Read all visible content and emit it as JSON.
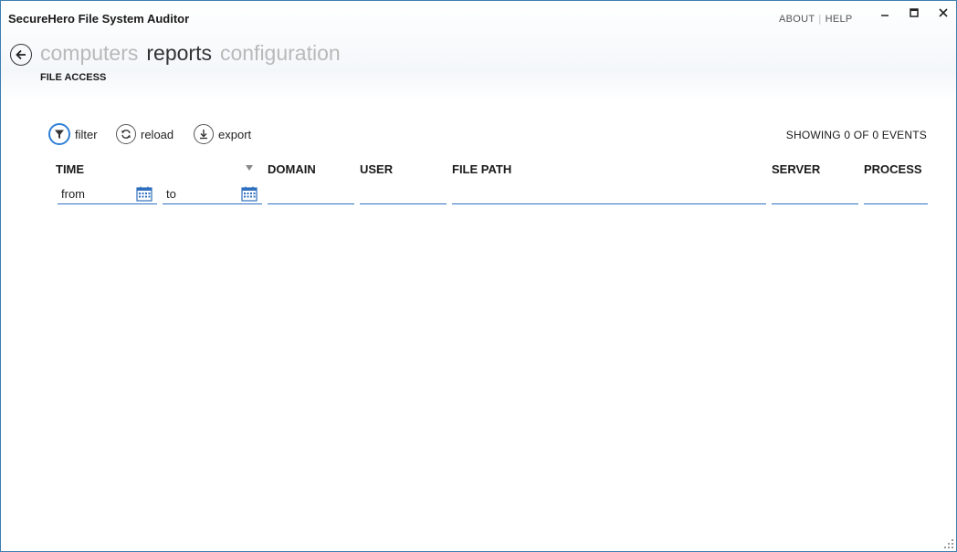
{
  "window": {
    "title": "SecureHero File System Auditor",
    "links": {
      "about": "ABOUT",
      "separator": "|",
      "help": "HELP"
    },
    "controls": {
      "minimize": "–",
      "maximize": "□",
      "close": "✕"
    }
  },
  "nav": {
    "items": [
      {
        "label": "computers",
        "state": "inactive"
      },
      {
        "label": "reports",
        "state": "active"
      },
      {
        "label": "configuration",
        "state": "inactive"
      }
    ],
    "section": "FILE ACCESS"
  },
  "toolbar": {
    "filter_label": "filter",
    "reload_label": "reload",
    "export_label": "export",
    "events_status": "SHOWING 0 OF 0 EVENTS"
  },
  "table": {
    "columns": [
      "TIME",
      "DOMAIN",
      "USER",
      "FILE PATH",
      "SERVER",
      "PROCESS"
    ],
    "filters": {
      "time_from_placeholder": "from",
      "time_to_placeholder": "to",
      "domain_value": "",
      "user_value": "",
      "file_path_value": "",
      "server_value": "",
      "process_value": ""
    }
  },
  "colors": {
    "accent": "#2f6fbf",
    "window_border": "#3c7fb1",
    "nav_inactive": "#b9b9b9",
    "nav_active": "#333333"
  },
  "icons": {
    "back": "back-arrow-icon",
    "filter": "filter-funnel-icon",
    "reload": "reload-icon",
    "export": "download-icon",
    "calendar": "calendar-icon",
    "sort": "sort-descending-icon"
  }
}
